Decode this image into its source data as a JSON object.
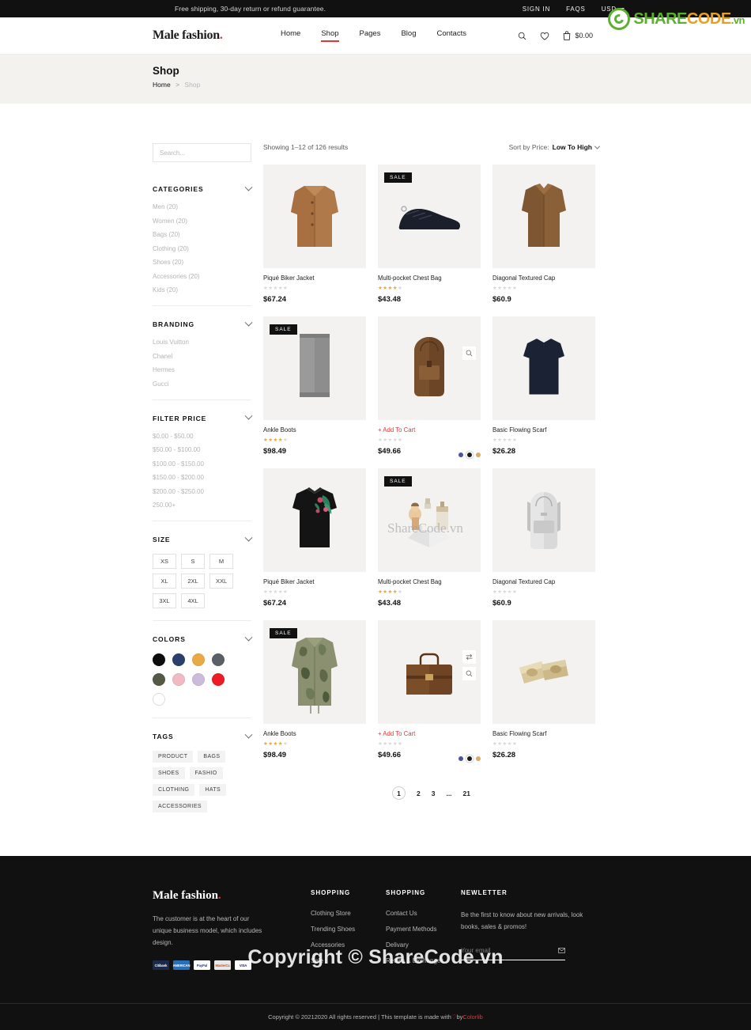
{
  "topbar": {
    "promo": "Free shipping, 30-day return or refund guarantee.",
    "signin": "SIGN IN",
    "faqs": "FAQS",
    "currency": "USD"
  },
  "watermark": {
    "brand_share": "SHARE",
    "brand_code": "CODE",
    "brand_vn": ".vn",
    "big_text": "Copyright © ShareCode.vn",
    "mid_text": "ShareCode.vn"
  },
  "header": {
    "logo": "Male fashion",
    "logo_dot": ".",
    "nav": [
      {
        "label": "Home",
        "active": false
      },
      {
        "label": "Shop",
        "active": true
      },
      {
        "label": "Pages",
        "active": false
      },
      {
        "label": "Blog",
        "active": false
      },
      {
        "label": "Contacts",
        "active": false
      }
    ],
    "icons": {
      "search": "search-icon",
      "wishlist": "heart-icon",
      "cart": "cart-icon",
      "cart_total": "$0.00"
    }
  },
  "breadcrumb": {
    "title": "Shop",
    "home": "Home",
    "separator": ">",
    "current": "Shop"
  },
  "sidebar": {
    "search_placeholder": "Search...",
    "widgets": [
      {
        "title": "CATEGORIES",
        "items": [
          "Men (20)",
          "Women (20)",
          "Bags (20)",
          "Clothing (20)",
          "Shoes (20)",
          "Accessories (20)",
          "Kids (20)"
        ]
      },
      {
        "title": "BRANDING",
        "items": [
          "Louis Vuitton",
          "Chanel",
          "Hermes",
          "Gucci"
        ]
      },
      {
        "title": "FILTER PRICE",
        "items": [
          "$0.00 - $50.00",
          "$50.00 - $100.00",
          "$100.00 - $150.00",
          "$150.00 - $200.00",
          "$200.00 - $250.00",
          "250.00+"
        ]
      }
    ],
    "size": {
      "title": "SIZE",
      "options": [
        "XS",
        "S",
        "M",
        "XL",
        "2XL",
        "XXL",
        "3XL",
        "4XL"
      ]
    },
    "colors": {
      "title": "COLORS",
      "swatches": [
        "#0d0d0d",
        "#2b3f6c",
        "#eaa945",
        "#5b5f66",
        "#545a46",
        "#f0b9c4",
        "#cbbcdb",
        "#ec1c24",
        "#ffffff"
      ]
    },
    "tags": {
      "title": "TAGS",
      "items": [
        "PRODUCT",
        "BAGS",
        "SHOES",
        "FASHIO",
        "CLOTHING",
        "HATS",
        "ACCESSORIES"
      ]
    }
  },
  "list_topbar": {
    "results": "Showing 1–12 of 126 results",
    "sort_label": "Sort by Price:",
    "sort_value": "Low To High"
  },
  "products": [
    {
      "name": "Piqué Biker Jacket",
      "price": "$67.24",
      "rating": 0,
      "sale": false,
      "kind": "jacket-tan",
      "swatches": [],
      "hover": []
    },
    {
      "name": "Multi-pocket Chest Bag",
      "price": "$43.48",
      "rating": 4,
      "sale": true,
      "kind": "sneaker-navy",
      "swatches": [],
      "hover": []
    },
    {
      "name": "Diagonal Textured Cap",
      "price": "$60.9",
      "rating": 0,
      "sale": false,
      "kind": "shirt-brown",
      "swatches": [],
      "hover": []
    },
    {
      "name": "Ankle Boots",
      "price": "$98.49",
      "rating": 4,
      "sale": true,
      "kind": "scarf-grey",
      "swatches": [],
      "hover": []
    },
    {
      "name": "+ Add To Cart",
      "price": "$49.66",
      "rating": 0,
      "sale": false,
      "kind": "backpack-brown",
      "swatches": [
        "#4b4fa5",
        "#1c1c1c",
        "#d9ab6a"
      ],
      "hover": [
        "search-icon"
      ],
      "is_cart": true
    },
    {
      "name": "Basic Flowing Scarf",
      "price": "$26.28",
      "rating": 0,
      "sale": false,
      "kind": "tshirt-navy",
      "swatches": [],
      "hover": []
    },
    {
      "name": "Piqué Biker Jacket",
      "price": "$67.24",
      "rating": 0,
      "sale": false,
      "kind": "tshirt-black-floral",
      "swatches": [],
      "hover": []
    },
    {
      "name": "Multi-pocket Chest Bag",
      "price": "$43.48",
      "rating": 4,
      "sale": true,
      "kind": "perfume-set",
      "swatches": [],
      "hover": []
    },
    {
      "name": "Diagonal Textured Cap",
      "price": "$60.9",
      "rating": 0,
      "sale": false,
      "kind": "backpack-grey",
      "swatches": [],
      "hover": []
    },
    {
      "name": "Ankle Boots",
      "price": "$98.49",
      "rating": 4,
      "sale": true,
      "kind": "jacket-camo",
      "swatches": [],
      "hover": []
    },
    {
      "name": "+ Add To Cart",
      "price": "$49.66",
      "rating": 0,
      "sale": false,
      "kind": "briefcase-brown",
      "swatches": [
        "#4b4fa5",
        "#1c1c1c",
        "#d9ab6a"
      ],
      "hover": [
        "compare-icon",
        "search-icon"
      ],
      "is_cart": true
    },
    {
      "name": "Basic Flowing Scarf",
      "price": "$26.28",
      "rating": 0,
      "sale": false,
      "kind": "cufflinks-gold",
      "swatches": [],
      "hover": []
    }
  ],
  "pagination": [
    "1",
    "2",
    "3",
    "...",
    "21"
  ],
  "footer": {
    "logo": "Male fashion",
    "logo_dot": ".",
    "about": "The customer is at the heart of our unique business model, which includes design.",
    "payment_cards": [
      "Citibank",
      "AMERICAN EXPRESS",
      "PayPal",
      "MasterCard",
      "VISA"
    ],
    "col2": {
      "title": "SHOPPING",
      "links": [
        "Clothing Store",
        "Trending Shoes",
        "Accessories",
        "Sale"
      ]
    },
    "col3": {
      "title": "SHOPPING",
      "links": [
        "Contact Us",
        "Payment Methods",
        "Delivary",
        "Return & Exchanges"
      ]
    },
    "newsletter": {
      "title": "NEWLETTER",
      "text": "Be the first to know about new arrivals, look books, sales & promos!",
      "placeholder": "Your email",
      "submit_icon": "envelope-icon"
    },
    "copyright_pre": "Copyright © 20212020 All rights reserved | This template is made with ",
    "copyright_heart": "♡",
    "copyright_by": " by ",
    "copyright_brand": "Colorlib"
  }
}
